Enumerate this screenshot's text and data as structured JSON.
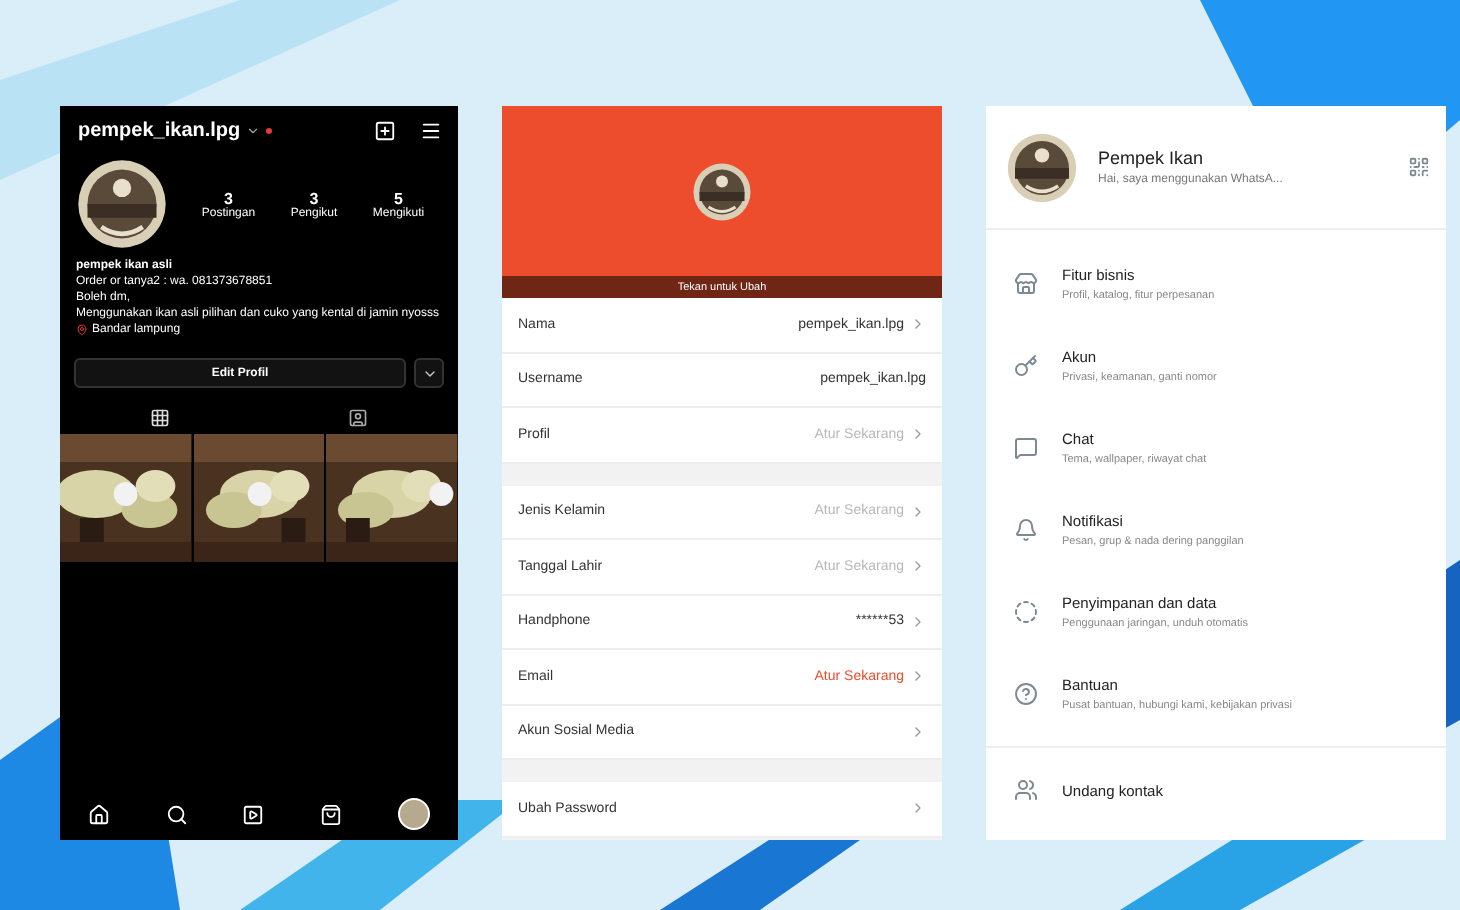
{
  "instagram": {
    "username": "pempek_ikan.lpg",
    "stats": [
      {
        "count": "3",
        "label": "Postingan"
      },
      {
        "count": "3",
        "label": "Pengikut"
      },
      {
        "count": "5",
        "label": "Mengikuti"
      }
    ],
    "bio": {
      "name": "pempek ikan asli",
      "lines": [
        "Order or tanya2 : wa. 081373678851",
        "Boleh dm,",
        "Menggunakan ikan asli pilihan dan cuko yang kental di jamin nyosss"
      ],
      "location": "Bandar lampung"
    },
    "edit_button": "Edit Profil"
  },
  "shop_profile": {
    "photo_caption": "Tekan untuk Ubah",
    "groups": [
      [
        {
          "label": "Nama",
          "value": "pempek_ikan.lpg",
          "color": "#333333",
          "chevron": true
        },
        {
          "label": "Username",
          "value": "pempek_ikan.lpg",
          "color": "#333333",
          "chevron": false
        },
        {
          "label": "Profil",
          "value": "Atur Sekarang",
          "color": "#b8b8b8",
          "chevron": true
        }
      ],
      [
        {
          "label": "Jenis Kelamin",
          "value": "Atur Sekarang",
          "color": "#b8b8b8",
          "chevron": true
        },
        {
          "label": "Tanggal Lahir",
          "value": "Atur Sekarang",
          "color": "#b8b8b8",
          "chevron": true
        },
        {
          "label": "Handphone",
          "value": "******53",
          "color": "#333333",
          "chevron": true
        },
        {
          "label": "Email",
          "value": "Atur Sekarang",
          "color": "#ee4d2d",
          "chevron": true
        },
        {
          "label": "Akun Sosial Media",
          "chevron": true
        }
      ],
      [
        {
          "label": "Ubah Password",
          "chevron": true
        }
      ]
    ]
  },
  "whatsapp_settings": {
    "name": "Pempek Ikan",
    "status": "Hai, saya menggunakan WhatsA...",
    "items": [
      {
        "kind": "store",
        "title": "Fitur bisnis",
        "subtitle": "Profil, katalog, fitur perpesanan"
      },
      {
        "kind": "key",
        "title": "Akun",
        "subtitle": "Privasi, keamanan, ganti nomor"
      },
      {
        "kind": "chat",
        "title": "Chat",
        "subtitle": "Tema, wallpaper, riwayat chat"
      },
      {
        "kind": "bell",
        "title": "Notifikasi",
        "subtitle": "Pesan, grup & nada dering panggilan"
      },
      {
        "kind": "storage",
        "title": "Penyimpanan dan data",
        "subtitle": "Penggunaan jaringan, unduh otomatis"
      },
      {
        "kind": "help",
        "title": "Bantuan",
        "subtitle": "Pusat bantuan, hubungi kami, kebijakan privasi"
      },
      {
        "kind": "invite",
        "title": "Undang kontak"
      }
    ]
  }
}
